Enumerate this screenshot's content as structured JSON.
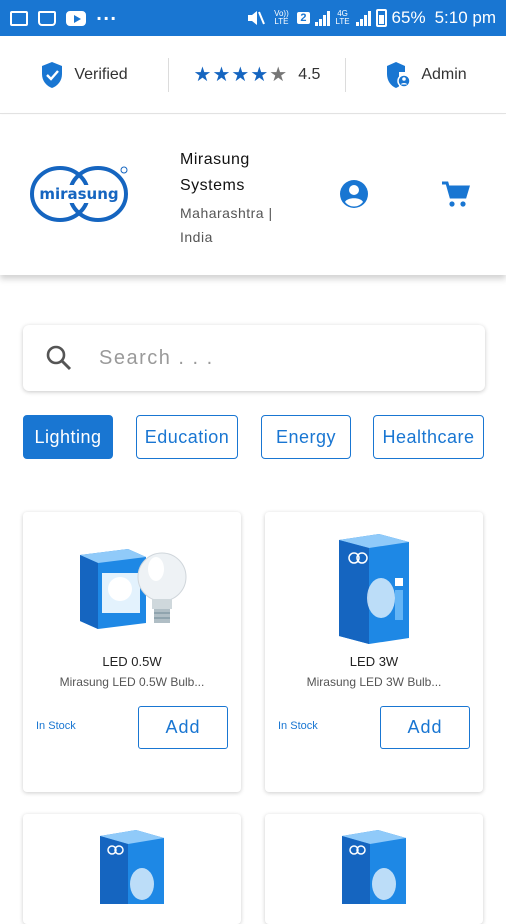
{
  "status_bar": {
    "more": "···",
    "volte": "Vo)) LTE",
    "sim": "2",
    "network": "4G LTE",
    "battery": "65%",
    "time": "5:10 pm"
  },
  "trust_bar": {
    "verified": "Verified",
    "rating_stars": "★★★★",
    "rating_star_grey": "★",
    "rating": "4.5",
    "admin": "Admin"
  },
  "store": {
    "logo_text": "mirasung",
    "name_line1": "Mirasung",
    "name_line2": "Systems",
    "location_line1": "Maharashtra |",
    "location_line2": "India"
  },
  "search": {
    "placeholder": "Search . . ."
  },
  "categories": [
    {
      "label": "Lighting",
      "active": true
    },
    {
      "label": "Education",
      "active": false
    },
    {
      "label": "Energy",
      "active": false
    },
    {
      "label": "Healthcare",
      "active": false
    }
  ],
  "products": [
    {
      "title": "LED 0.5W",
      "subtitle": "Mirasung LED 0.5W Bulb...",
      "stock": "In Stock",
      "add_label": "Add"
    },
    {
      "title": "LED 3W",
      "subtitle": "Mirasung LED 3W Bulb...",
      "stock": "In Stock",
      "add_label": "Add"
    }
  ],
  "colors": {
    "primary": "#1976d2",
    "star": "#1565c0"
  }
}
